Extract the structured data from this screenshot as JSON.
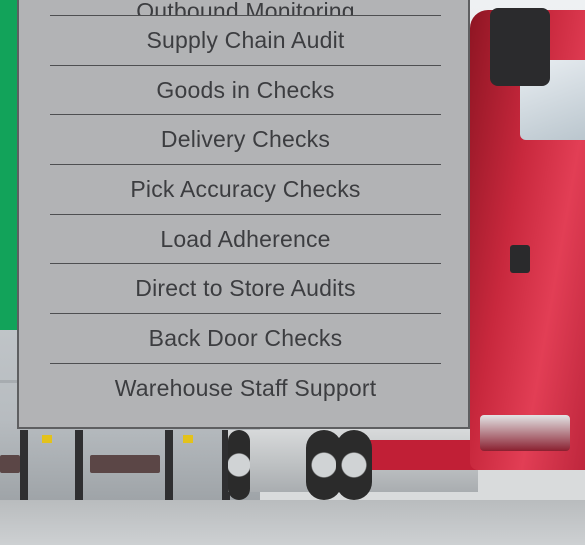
{
  "menu": {
    "items": [
      {
        "label": "Outbound Monitoring"
      },
      {
        "label": "Supply Chain Audit"
      },
      {
        "label": "Goods in Checks"
      },
      {
        "label": "Delivery Checks"
      },
      {
        "label": "Pick Accuracy Checks"
      },
      {
        "label": "Load Adherence"
      },
      {
        "label": "Direct to Store Audits"
      },
      {
        "label": "Back Door Checks"
      },
      {
        "label": "Warehouse Staff Support"
      }
    ]
  },
  "colors": {
    "menu_background": "#b2b3b5",
    "menu_text": "#3c3d40",
    "brand_green": "#12a35a",
    "truck_red": "#c8283d"
  }
}
